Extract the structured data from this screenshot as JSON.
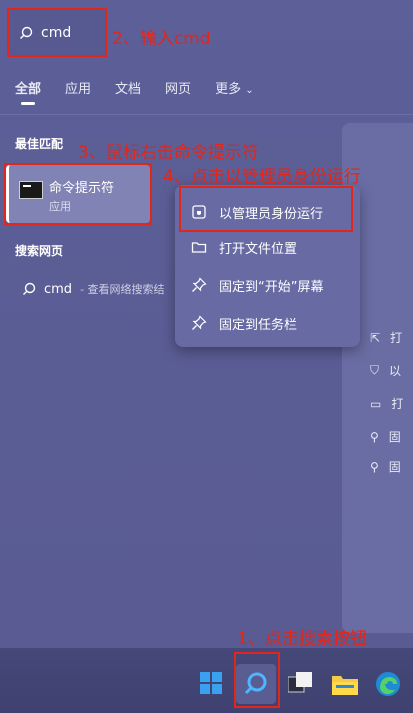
{
  "search": {
    "query": "cmd"
  },
  "tabs": [
    "全部",
    "应用",
    "文档",
    "网页",
    "更多"
  ],
  "sections": {
    "best_match": "最佳匹配",
    "search_web": "搜索网页"
  },
  "best_match": {
    "title": "命令提示符",
    "subtitle": "应用"
  },
  "web_result": {
    "title": "cmd",
    "desc": "- 查看网络搜索结"
  },
  "context_menu": [
    {
      "label": "以管理员身份运行",
      "icon": "shield-icon"
    },
    {
      "label": "打开文件位置",
      "icon": "folder-icon"
    },
    {
      "label": "固定到“开始”屏幕",
      "icon": "pin-icon"
    },
    {
      "label": "固定到任务栏",
      "icon": "pin-icon"
    }
  ],
  "right_panel": [
    "打",
    "以",
    "打",
    "固",
    "固"
  ],
  "annotations": {
    "step1": "1、点击搜索按钮",
    "step2": "2、输入cmd",
    "step3": "3、鼠标右击命令提示符",
    "step4": "4、点击以管理员身份运行"
  },
  "colors": {
    "annotation": "#e2261b",
    "panel": "#5b5e97",
    "taskbar": "#41446f"
  }
}
